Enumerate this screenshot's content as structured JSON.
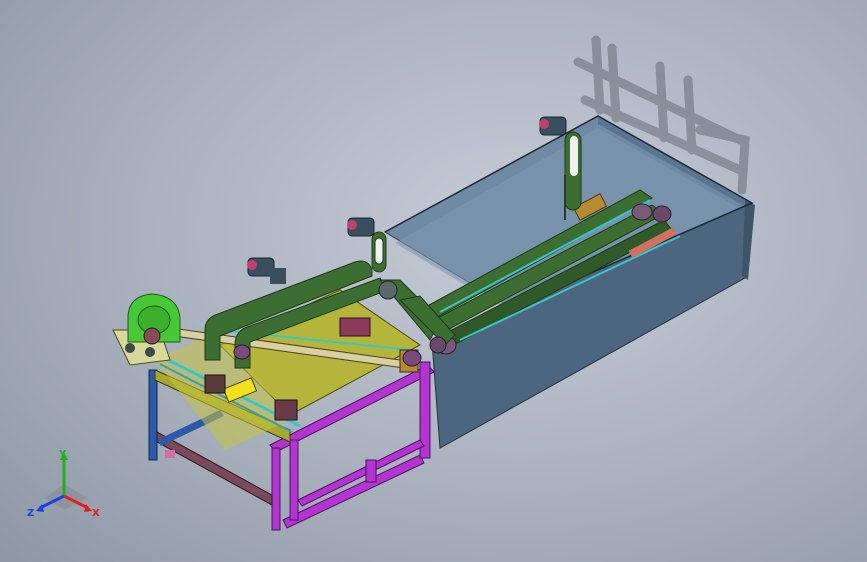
{
  "viewport": {
    "background_color": "#a9b1bd"
  },
  "model": {
    "tank_color": "#4d6680",
    "frame_color": "#b434d0",
    "conveyor_color": "#3c6e32",
    "bed_color": "#b5b53c",
    "rail_color": "#35c8c8",
    "motor_color": "#3a4f5e",
    "guard_color": "#48c836"
  },
  "triad": {
    "axis_x": "X",
    "axis_y": "Y",
    "axis_z": "Z",
    "x_color": "#e02020",
    "y_color": "#20b020",
    "z_color": "#2040e0"
  }
}
